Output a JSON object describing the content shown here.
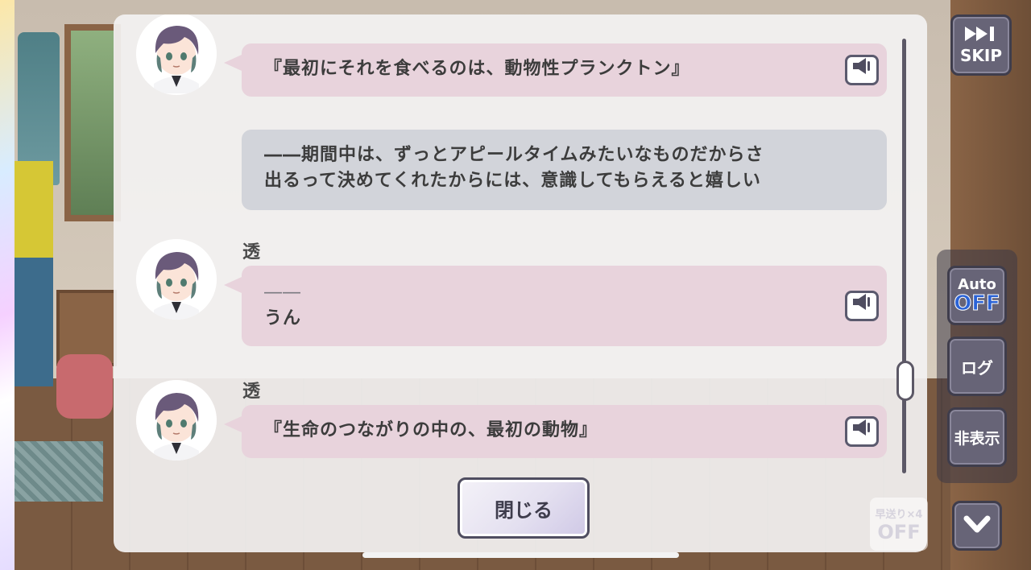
{
  "log": {
    "entries": [
      {
        "speaker": "",
        "type": "pink",
        "lines": [
          "『最初にそれを食べるのは、動物性プランクトン』"
        ],
        "has_avatar": true,
        "has_voice": true
      },
      {
        "speaker": "",
        "type": "gray",
        "lines": [
          "――期間中は、ずっとアピールタイムみたいなものだからさ",
          "出るって決めてくれたからには、意識してもらえると嬉しい"
        ],
        "has_avatar": false,
        "has_voice": false
      },
      {
        "speaker": "透",
        "type": "pink",
        "lines": [
          "――",
          "うん"
        ],
        "has_avatar": true,
        "has_voice": true
      },
      {
        "speaker": "透",
        "type": "pink",
        "lines": [
          "『生命のつながりの中の、最初の動物』"
        ],
        "has_avatar": true,
        "has_voice": true
      }
    ],
    "close_label": "閉じる"
  },
  "controls": {
    "skip_label": "SKIP",
    "auto_label": "Auto",
    "auto_value": "OFF",
    "log_label": "ログ",
    "hide_label": "非表示",
    "speed_label": "早送り×4",
    "speed_value": "OFF"
  },
  "icons": {
    "skip": "fast-forward-icon",
    "voice": "speaker-icon",
    "down": "chevron-down-icon"
  },
  "colors": {
    "pink_bubble": "#e8d3dc",
    "gray_bubble": "#d2d4da",
    "button": "#676477",
    "auto_off": "#2b63d6"
  }
}
